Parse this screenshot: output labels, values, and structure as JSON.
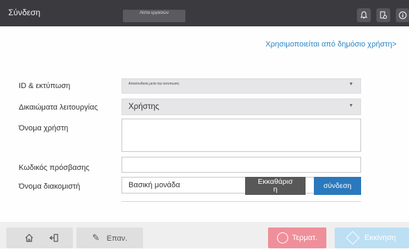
{
  "topbar": {
    "title": "Σύνδεση",
    "jobs_label": "Λίστα εργασιών",
    "icons": [
      "bell-icon",
      "device-settings-icon",
      "info-icon"
    ]
  },
  "main": {
    "public_user_link": "Χρησιμοποιείται από δημόσιο χρήστη>",
    "fields": {
      "id_print_label": "ID & εκτύπωση",
      "id_print_value": "Αποσυνδεση μετα την εκτυπωση",
      "function_rights_label": "Δικαιώματα λειτουργίας",
      "function_rights_value": "Χρήστης",
      "username_label": "Όνομα χρήστη",
      "username_value": "",
      "password_label": "Κωδικός πρόσβασης",
      "password_value": "",
      "server_name_label": "Όνομα διακομιστή",
      "server_name_value": "Βασική μονάδα"
    },
    "buttons": {
      "clear": "Εκκαθάρισ\nη",
      "login": "σύνδεση"
    }
  },
  "bottombar": {
    "home_icon": "home-icon",
    "exit_icon": "exit-icon",
    "edit_label": "Επαν.",
    "stop_label": "Τερματ.",
    "start_label": "Εκκίνηση"
  }
}
